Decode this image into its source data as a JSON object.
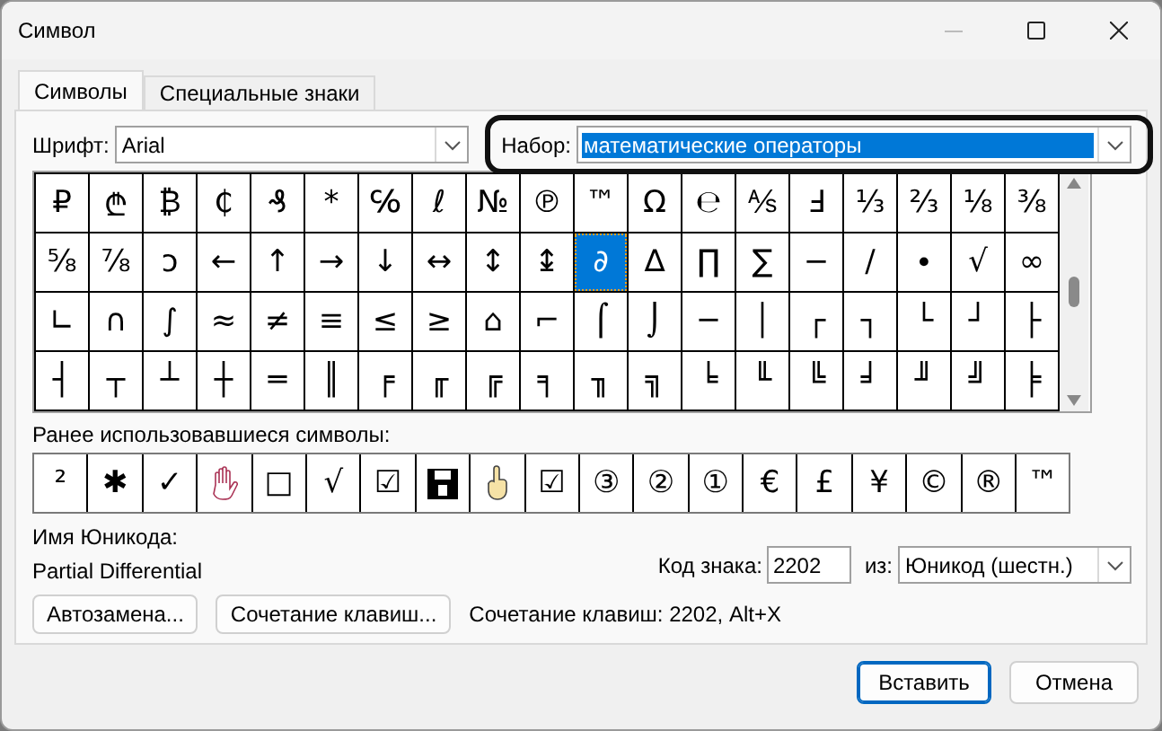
{
  "window": {
    "title": "Символ"
  },
  "tabs": [
    {
      "label": "Символы",
      "selected": true
    },
    {
      "label": "Специальные знаки",
      "selected": false
    }
  ],
  "font_field": {
    "label": "Шрифт:",
    "value": "Arial"
  },
  "set_field": {
    "label": "Набор:",
    "value": "математические операторы",
    "highlighted": true
  },
  "symbol_grid": {
    "rows": [
      [
        {
          "char": "₽",
          "selected": false
        },
        {
          "char": "₾",
          "selected": false
        },
        {
          "char": "₿",
          "selected": false
        },
        {
          "char": "₵",
          "selected": false
        },
        {
          "char": "₰",
          "selected": false
        },
        {
          "char": "*",
          "selected": false
        },
        {
          "char": "℅",
          "selected": false
        },
        {
          "char": "ℓ",
          "selected": false
        },
        {
          "char": "№",
          "selected": false
        },
        {
          "char": "℗",
          "selected": false
        },
        {
          "char": "™",
          "selected": false
        },
        {
          "char": "Ω",
          "selected": false
        },
        {
          "char": "℮",
          "selected": false
        },
        {
          "char": "⅍",
          "selected": false
        },
        {
          "char": "Ⅎ",
          "selected": false
        },
        {
          "char": "⅓",
          "selected": false
        },
        {
          "char": "⅔",
          "selected": false
        },
        {
          "char": "⅛",
          "selected": false
        },
        {
          "char": "⅜",
          "selected": false
        }
      ],
      [
        {
          "char": "⅝",
          "selected": false
        },
        {
          "char": "⅞",
          "selected": false
        },
        {
          "char": "ↄ",
          "selected": false
        },
        {
          "char": "←",
          "selected": false
        },
        {
          "char": "↑",
          "selected": false
        },
        {
          "char": "→",
          "selected": false
        },
        {
          "char": "↓",
          "selected": false
        },
        {
          "char": "↔",
          "selected": false
        },
        {
          "char": "↕",
          "selected": false
        },
        {
          "char": "↨",
          "selected": false
        },
        {
          "char": "∂",
          "selected": true
        },
        {
          "char": "∆",
          "selected": false
        },
        {
          "char": "∏",
          "selected": false
        },
        {
          "char": "∑",
          "selected": false
        },
        {
          "char": "−",
          "selected": false
        },
        {
          "char": "∕",
          "selected": false
        },
        {
          "char": "∙",
          "selected": false
        },
        {
          "char": "√",
          "selected": false
        },
        {
          "char": "∞",
          "selected": false
        }
      ],
      [
        {
          "char": "∟",
          "selected": false
        },
        {
          "char": "∩",
          "selected": false
        },
        {
          "char": "∫",
          "selected": false
        },
        {
          "char": "≈",
          "selected": false
        },
        {
          "char": "≠",
          "selected": false
        },
        {
          "char": "≡",
          "selected": false
        },
        {
          "char": "≤",
          "selected": false
        },
        {
          "char": "≥",
          "selected": false
        },
        {
          "char": "⌂",
          "selected": false
        },
        {
          "char": "⌐",
          "selected": false
        },
        {
          "char": "⌠",
          "selected": false
        },
        {
          "char": "⌡",
          "selected": false
        },
        {
          "char": "─",
          "selected": false
        },
        {
          "char": "│",
          "selected": false
        },
        {
          "char": "┌",
          "selected": false
        },
        {
          "char": "┐",
          "selected": false
        },
        {
          "char": "└",
          "selected": false
        },
        {
          "char": "┘",
          "selected": false
        },
        {
          "char": "├",
          "selected": false
        }
      ],
      [
        {
          "char": "┤",
          "selected": false
        },
        {
          "char": "┬",
          "selected": false
        },
        {
          "char": "┴",
          "selected": false
        },
        {
          "char": "┼",
          "selected": false
        },
        {
          "char": "═",
          "selected": false
        },
        {
          "char": "║",
          "selected": false
        },
        {
          "char": "╒",
          "selected": false
        },
        {
          "char": "╓",
          "selected": false
        },
        {
          "char": "╔",
          "selected": false
        },
        {
          "char": "╕",
          "selected": false
        },
        {
          "char": "╖",
          "selected": false
        },
        {
          "char": "╗",
          "selected": false
        },
        {
          "char": "╘",
          "selected": false
        },
        {
          "char": "╙",
          "selected": false
        },
        {
          "char": "╚",
          "selected": false
        },
        {
          "char": "╛",
          "selected": false
        },
        {
          "char": "╜",
          "selected": false
        },
        {
          "char": "╝",
          "selected": false
        },
        {
          "char": "╞",
          "selected": false
        }
      ]
    ]
  },
  "recent_symbols": {
    "label": "Ранее использовавшиеся символы:",
    "items": [
      {
        "kind": "char",
        "char": "²"
      },
      {
        "kind": "char",
        "char": "✱"
      },
      {
        "kind": "char",
        "char": "✓"
      },
      {
        "kind": "hand"
      },
      {
        "kind": "char",
        "char": "□"
      },
      {
        "kind": "char",
        "char": "√"
      },
      {
        "kind": "char",
        "char": "☑"
      },
      {
        "kind": "disk"
      },
      {
        "kind": "finger"
      },
      {
        "kind": "char",
        "char": "☑"
      },
      {
        "kind": "char",
        "char": "③"
      },
      {
        "kind": "char",
        "char": "②"
      },
      {
        "kind": "char",
        "char": "①"
      },
      {
        "kind": "char",
        "char": "€"
      },
      {
        "kind": "char",
        "char": "£"
      },
      {
        "kind": "char",
        "char": "¥"
      },
      {
        "kind": "char",
        "char": "©"
      },
      {
        "kind": "char",
        "char": "®"
      },
      {
        "kind": "char",
        "char": "™"
      }
    ]
  },
  "unicode_name": {
    "label": "Имя Юникода:",
    "value": "Partial Differential"
  },
  "code_field": {
    "label": "Код знака:",
    "value": "2202"
  },
  "from_field": {
    "label": "из:",
    "value": "Юникод (шестн.)"
  },
  "autocorrect_button": "Автозамена...",
  "shortcut_button": "Сочетание клавиш...",
  "shortcut_text": "Сочетание клавиш: 2202, Alt+X",
  "dialog_buttons": [
    {
      "label": "Вставить",
      "default": true
    },
    {
      "label": "Отмена",
      "default": false
    }
  ]
}
